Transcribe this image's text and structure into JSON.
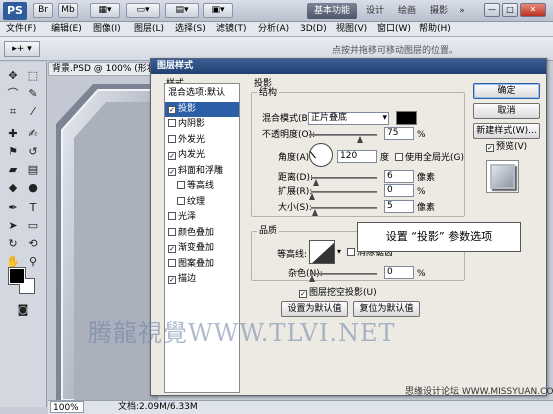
{
  "app": {
    "logo": "PS"
  },
  "titlebar": {
    "buttons": [
      "Br",
      "Mb",
      "▾",
      "▾"
    ],
    "workspaces": [
      "基本功能",
      "设计",
      "绘画",
      "摄影"
    ],
    "expand": "»",
    "window_controls": [
      "—",
      "□",
      "✕"
    ]
  },
  "menubar": {
    "items": [
      "文件(F)",
      "编辑(E)",
      "图像(I)",
      "图层(L)",
      "选择(S)",
      "滤镜(T)",
      "分析(A)",
      "3D(D)",
      "视图(V)",
      "窗口(W)",
      "帮助(H)"
    ]
  },
  "options": {
    "tool_icon": "▸+",
    "hint": "点按并拖移可移动图层的位置。"
  },
  "document": {
    "tab_title": "背景.PSD @ 100% (形状"
  },
  "statusbar": {
    "zoom": "100%",
    "docinfo": "文档:2.09M/6.33M"
  },
  "dialog": {
    "title": "图层样式",
    "style_header": "样式",
    "styles": [
      {
        "label": "混合选项:默认",
        "checkbox": false,
        "checked": false,
        "selected": false
      },
      {
        "label": "投影",
        "checkbox": true,
        "checked": true,
        "selected": true
      },
      {
        "label": "内阴影",
        "checkbox": true,
        "checked": false,
        "selected": false
      },
      {
        "label": "外发光",
        "checkbox": true,
        "checked": false,
        "selected": false
      },
      {
        "label": "内发光",
        "checkbox": true,
        "checked": true,
        "selected": false
      },
      {
        "label": "斜面和浮雕",
        "checkbox": true,
        "checked": true,
        "selected": false
      },
      {
        "label": "等高线",
        "checkbox": true,
        "checked": false,
        "selected": false,
        "indent": true
      },
      {
        "label": "纹理",
        "checkbox": true,
        "checked": false,
        "selected": false,
        "indent": true
      },
      {
        "label": "光泽",
        "checkbox": true,
        "checked": false,
        "selected": false
      },
      {
        "label": "颜色叠加",
        "checkbox": true,
        "checked": false,
        "selected": false
      },
      {
        "label": "渐变叠加",
        "checkbox": true,
        "checked": true,
        "selected": false
      },
      {
        "label": "图案叠加",
        "checkbox": true,
        "checked": false,
        "selected": false
      },
      {
        "label": "描边",
        "checkbox": true,
        "checked": true,
        "selected": false
      }
    ],
    "section": "投影",
    "structure": {
      "title": "结构",
      "blend_mode_label": "混合模式(B):",
      "blend_mode_value": "正片叠底",
      "opacity_label": "不透明度(O):",
      "opacity_value": "75",
      "opacity_unit": "%",
      "opacity_level": 0.75,
      "angle_label": "角度(A):",
      "angle_value": "120",
      "angle_unit": "度",
      "global_light_label": "使用全局光(G)",
      "distance_label": "距离(D):",
      "distance_value": "6",
      "distance_unit": "像素",
      "spread_label": "扩展(R):",
      "spread_value": "0",
      "spread_unit": "%",
      "size_label": "大小(S):",
      "size_value": "5",
      "size_unit": "像素"
    },
    "quality": {
      "title": "品质",
      "contour_label": "等高线:",
      "antialias_label": "消除锯齿",
      "noise_label": "杂色(N):",
      "noise_value": "0",
      "noise_unit": "%",
      "knockout_label": "图层挖空投影(U)",
      "knockout_checked": true
    },
    "buttons": {
      "make_default": "设置为默认值",
      "reset_default": "复位为默认值",
      "ok": "确定",
      "cancel": "取消",
      "new_style": "新建样式(W)...",
      "preview": "预览(V)",
      "preview_checked": true
    }
  },
  "callout": "设置 “投影” 参数选项",
  "watermarks": {
    "main": "腾龍視覺WWW.TLVI.NET",
    "corner": "思缘设计论坛 WWW.MISSYUAN.COM"
  },
  "colors": {
    "dialog_title": "#2d5ea8",
    "shadow_swatch": "#000000"
  }
}
